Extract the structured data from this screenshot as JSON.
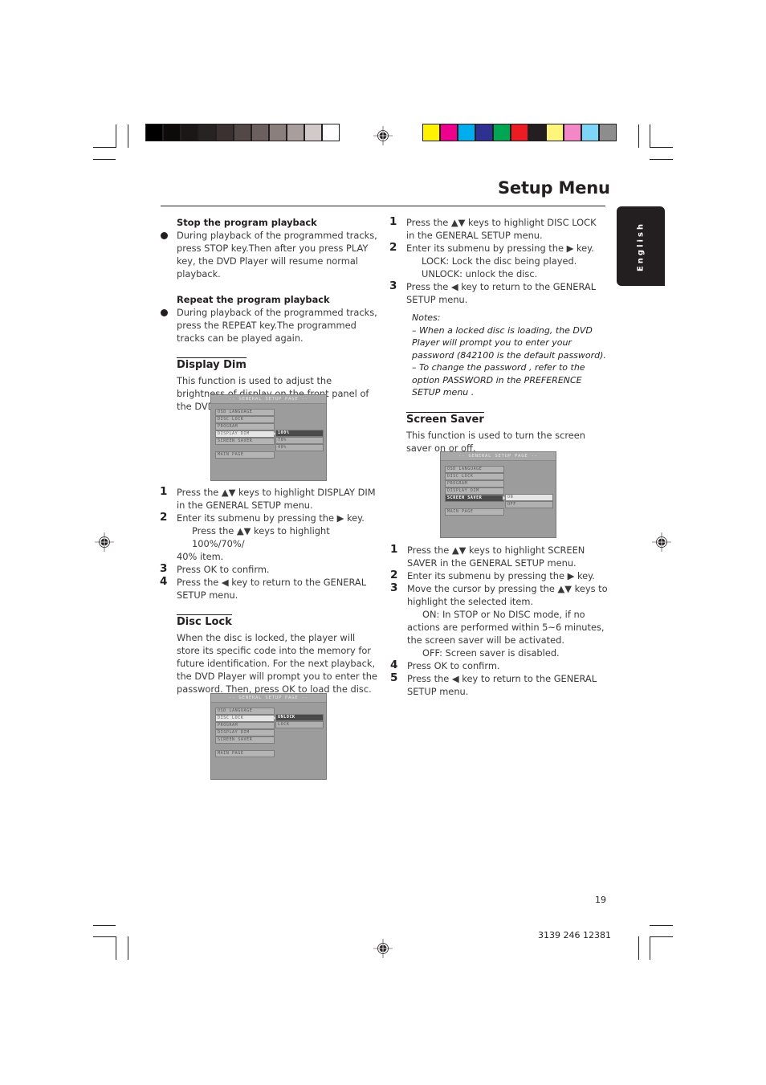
{
  "page_title": "Setup Menu",
  "language_tab": "English",
  "grayscale_swatches": [
    "#000000",
    "#0d0b0a",
    "#1a1716",
    "#272322",
    "#3a3130",
    "#524846",
    "#6b605e",
    "#8a7f7c",
    "#a89e9b",
    "#d2cac9",
    "#ffffff"
  ],
  "color_swatches": [
    "#fff200",
    "#ec008c",
    "#00aeef",
    "#2e3192",
    "#00a651",
    "#ed1c24",
    "#231f20",
    "#fff57a",
    "#f487c6",
    "#7dd6f7",
    "#8e8d8e"
  ],
  "left_col": {
    "stop_heading": "Stop the program playback",
    "stop_text": "During playback of the programmed tracks, press STOP key.Then after you press PLAY key, the DVD Player will resume normal playback.",
    "repeat_heading": "Repeat the program playback",
    "repeat_text": "During playback of the programmed tracks, press the REPEAT key.The programmed tracks can be played again.",
    "display_dim": {
      "heading": "Display Dim",
      "intro": "This function is used to adjust the brightness of display on the front panel of the DVD Player.",
      "steps": [
        {
          "num": "1",
          "text": "Press the ▲▼ keys to highlight  DISPLAY DIM in the GENERAL SETUP menu."
        },
        {
          "num": "2",
          "text": "Enter its submenu by pressing the ▶  key.",
          "sub": "Press the ▲▼ keys to highlight 100%/70%/",
          "sub2": "40% item."
        },
        {
          "num": "3",
          "text": "Press OK to confirm."
        },
        {
          "num": "4",
          "text": "Press the ◀ key to return to the GENERAL SETUP menu."
        }
      ]
    },
    "disc_lock": {
      "heading": "Disc Lock",
      "intro": "When the disc is locked, the player will store its specific code into the memory for future identification. For the next playback, the DVD Player will prompt you to enter the password. Then, press OK to load the disc."
    }
  },
  "right_col": {
    "disc_lock_steps": [
      {
        "num": "1",
        "text": "Press the ▲▼ keys to highlight DISC LOCK in the GENERAL SETUP menu."
      },
      {
        "num": "2",
        "text": "Enter its submenu by pressing the ▶  key.",
        "sub": "LOCK: Lock the disc being played.",
        "sub2": "UNLOCK: unlock the disc."
      },
      {
        "num": "3",
        "text": "Press the ◀ key to return to the GENERAL SETUP menu."
      }
    ],
    "notes_label": "Notes:",
    "note1": "–   When a locked disc is loading, the DVD Player will prompt you to enter your password (842100 is the default password).",
    "note2": "–   To change the password , refer to the option PASSWORD in the PREFERENCE SETUP menu .",
    "screen_saver": {
      "heading": "Screen Saver",
      "intro": "This function is used to turn the screen saver on or off.",
      "steps": [
        {
          "num": "1",
          "text": "Press the ▲▼ keys to highlight SCREEN SAVER in the GENERAL SETUP menu."
        },
        {
          "num": "2",
          "text": "Enter its submenu by pressing the ▶ key."
        },
        {
          "num": "3",
          "text": "Move the cursor by pressing the ▲▼ keys to highlight the selected item.",
          "sub": "ON: In STOP or No DISC mode, if no",
          "sub_rest": "actions are performed within 5~6 minutes, the screen saver will be activated.",
          "sub2": "OFF: Screen saver is disabled."
        },
        {
          "num": "4",
          "text": "Press OK to confirm."
        },
        {
          "num": "5",
          "text": "Press the ◀ key to return to the GENERAL SETUP menu."
        }
      ]
    }
  },
  "osd": {
    "title": "-- GENERAL SETUP PAGE --",
    "items": [
      "OSD LANGUAGE",
      "DISC LOCK",
      "PROGRAM",
      "DISPLAY DIM",
      "SCREEN SAVER"
    ],
    "main_page": "MAIN PAGE",
    "display_dim_options": [
      "100%",
      "70%",
      "40%"
    ],
    "disc_lock_options": [
      "UNLOCK",
      "LOCK"
    ],
    "screen_saver_options": [
      "ON",
      "OFF"
    ]
  },
  "footer": {
    "page_number": "19",
    "doc_code": "3139 246 12381"
  }
}
